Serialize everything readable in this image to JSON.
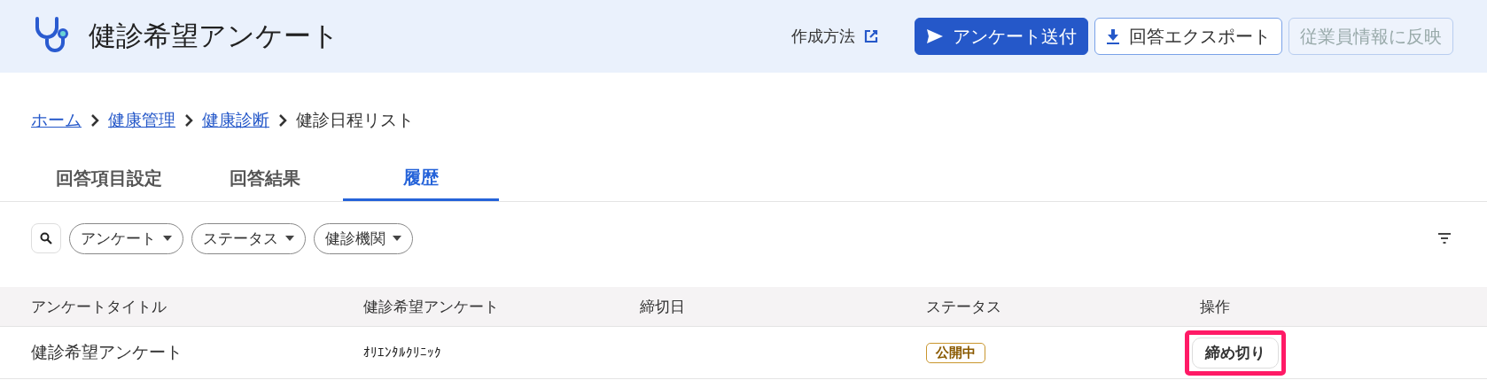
{
  "header": {
    "title": "健診希望アンケート",
    "help_link": "作成方法",
    "buttons": [
      {
        "label": "アンケート送付",
        "kind": "send",
        "disabled": false
      },
      {
        "label": "回答エクスポート",
        "kind": "export",
        "disabled": false
      },
      {
        "label": "従業員情報に反映",
        "kind": "plain",
        "disabled": true
      }
    ]
  },
  "breadcrumb": [
    {
      "label": "ホーム",
      "link": true
    },
    {
      "label": "健康管理",
      "link": true
    },
    {
      "label": "健康診断",
      "link": true
    },
    {
      "label": "健診日程リスト",
      "link": false
    }
  ],
  "tabs": [
    {
      "label": "回答項目設定",
      "selected": false
    },
    {
      "label": "回答結果",
      "selected": false
    },
    {
      "label": "履歴",
      "selected": true
    }
  ],
  "filters": [
    {
      "label": "アンケート"
    },
    {
      "label": "ステータス"
    },
    {
      "label": "健診機関"
    }
  ],
  "table": {
    "columns": [
      "アンケートタイトル",
      "健診希望アンケート",
      "締切日",
      "ステータス",
      "操作"
    ],
    "rows": [
      {
        "title": "健診希望アンケート",
        "clinic": "ｵﾘｴﾝﾀﾙｸﾘﾆｯｸ",
        "status": "公開中",
        "action": {
          "label": "締め切り",
          "highlighted": true
        }
      }
    ]
  }
}
